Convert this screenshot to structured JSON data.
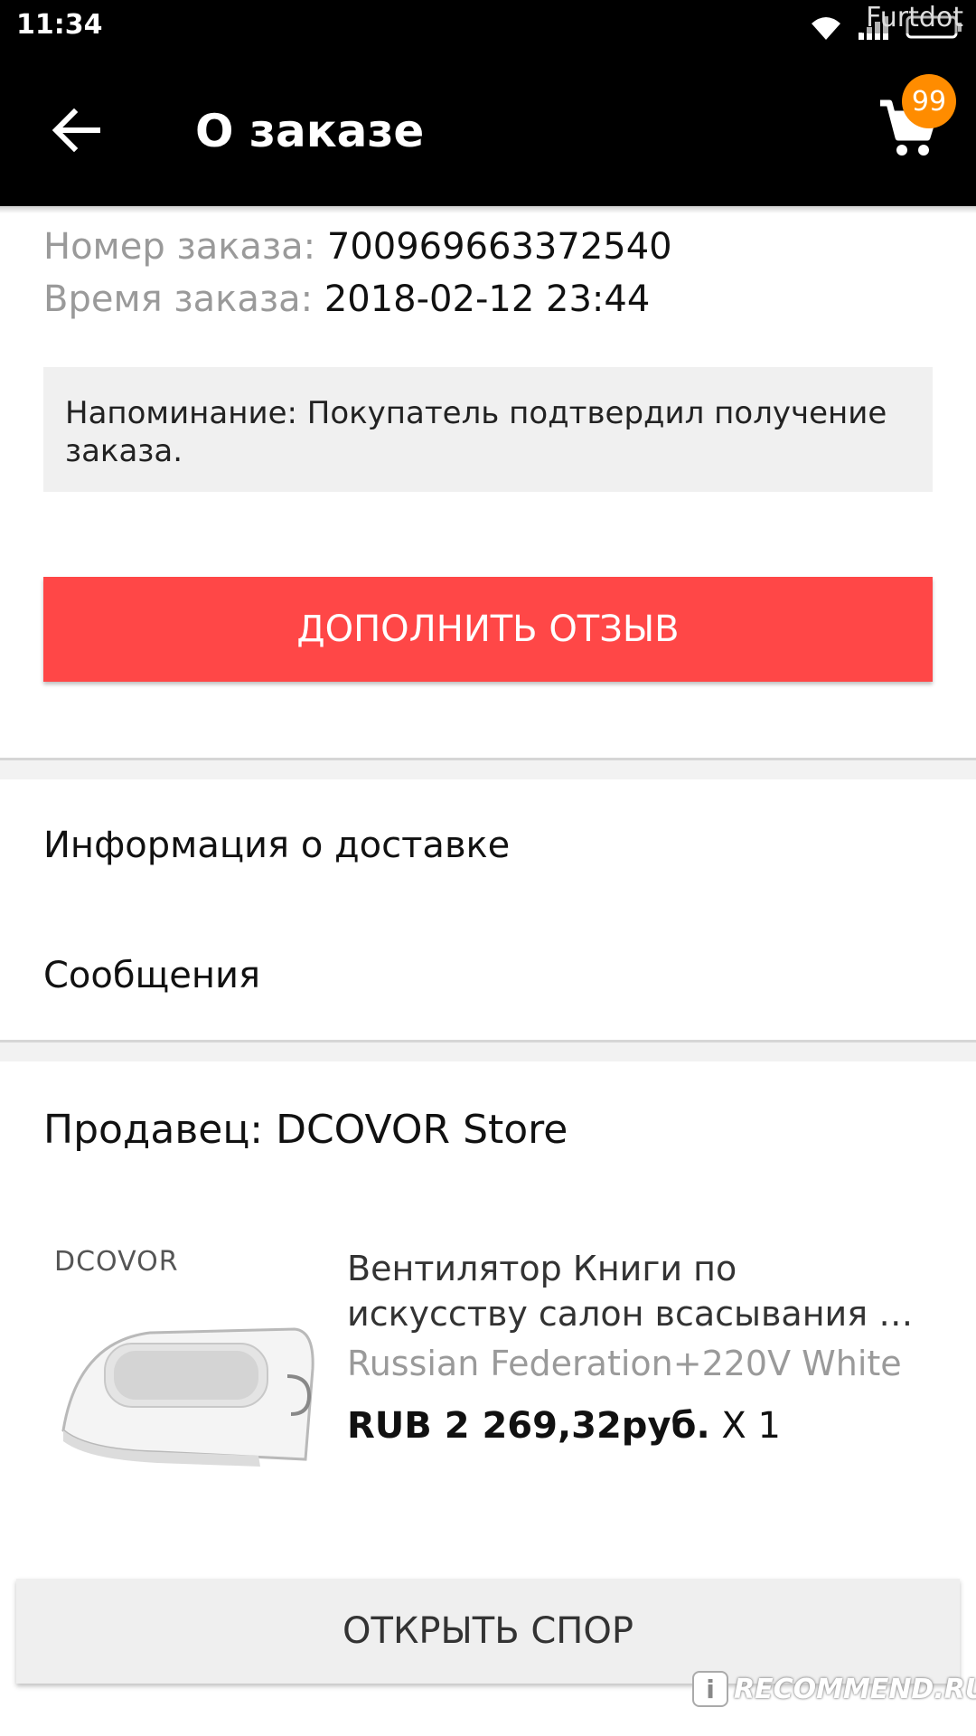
{
  "status_bar": {
    "time": "11:34",
    "watermark": "Furtdot",
    "icons": [
      "wifi-icon",
      "signal-icon",
      "battery-icon"
    ]
  },
  "app_bar": {
    "title": "О заказе",
    "cart_badge": "99",
    "icons": [
      "back-arrow-icon",
      "cart-icon"
    ]
  },
  "order": {
    "number_label": "Номер заказа:",
    "number_value": "700969663372540",
    "time_label": "Время заказа:",
    "time_value": "2018-02-12 23:44",
    "reminder": "Напоминание: Покупатель подтвердил получение заказа."
  },
  "buttons": {
    "review": "ДОПОЛНИТЬ ОТЗЫВ",
    "dispute": "ОТКРЫТЬ СПОР"
  },
  "menu": {
    "delivery": "Информация о доставке",
    "messages": "Сообщения"
  },
  "seller": {
    "label": "Продавец: DCOVOR Store"
  },
  "product": {
    "brand_logo": "DCOVOR",
    "title_line1": "Вентилятор Книги по",
    "title_line2": "искусству салон всасывания П...",
    "variant": "Russian Federation+220V White",
    "price": "RUB 2 269,32руб.",
    "quantity": " X 1"
  },
  "watermark_bottom": {
    "text": "RECOMMEND.RU",
    "logo": "i"
  },
  "colors": {
    "accent_red": "#ff4747",
    "badge_orange": "#ff8c00",
    "bar_black": "#000000"
  }
}
